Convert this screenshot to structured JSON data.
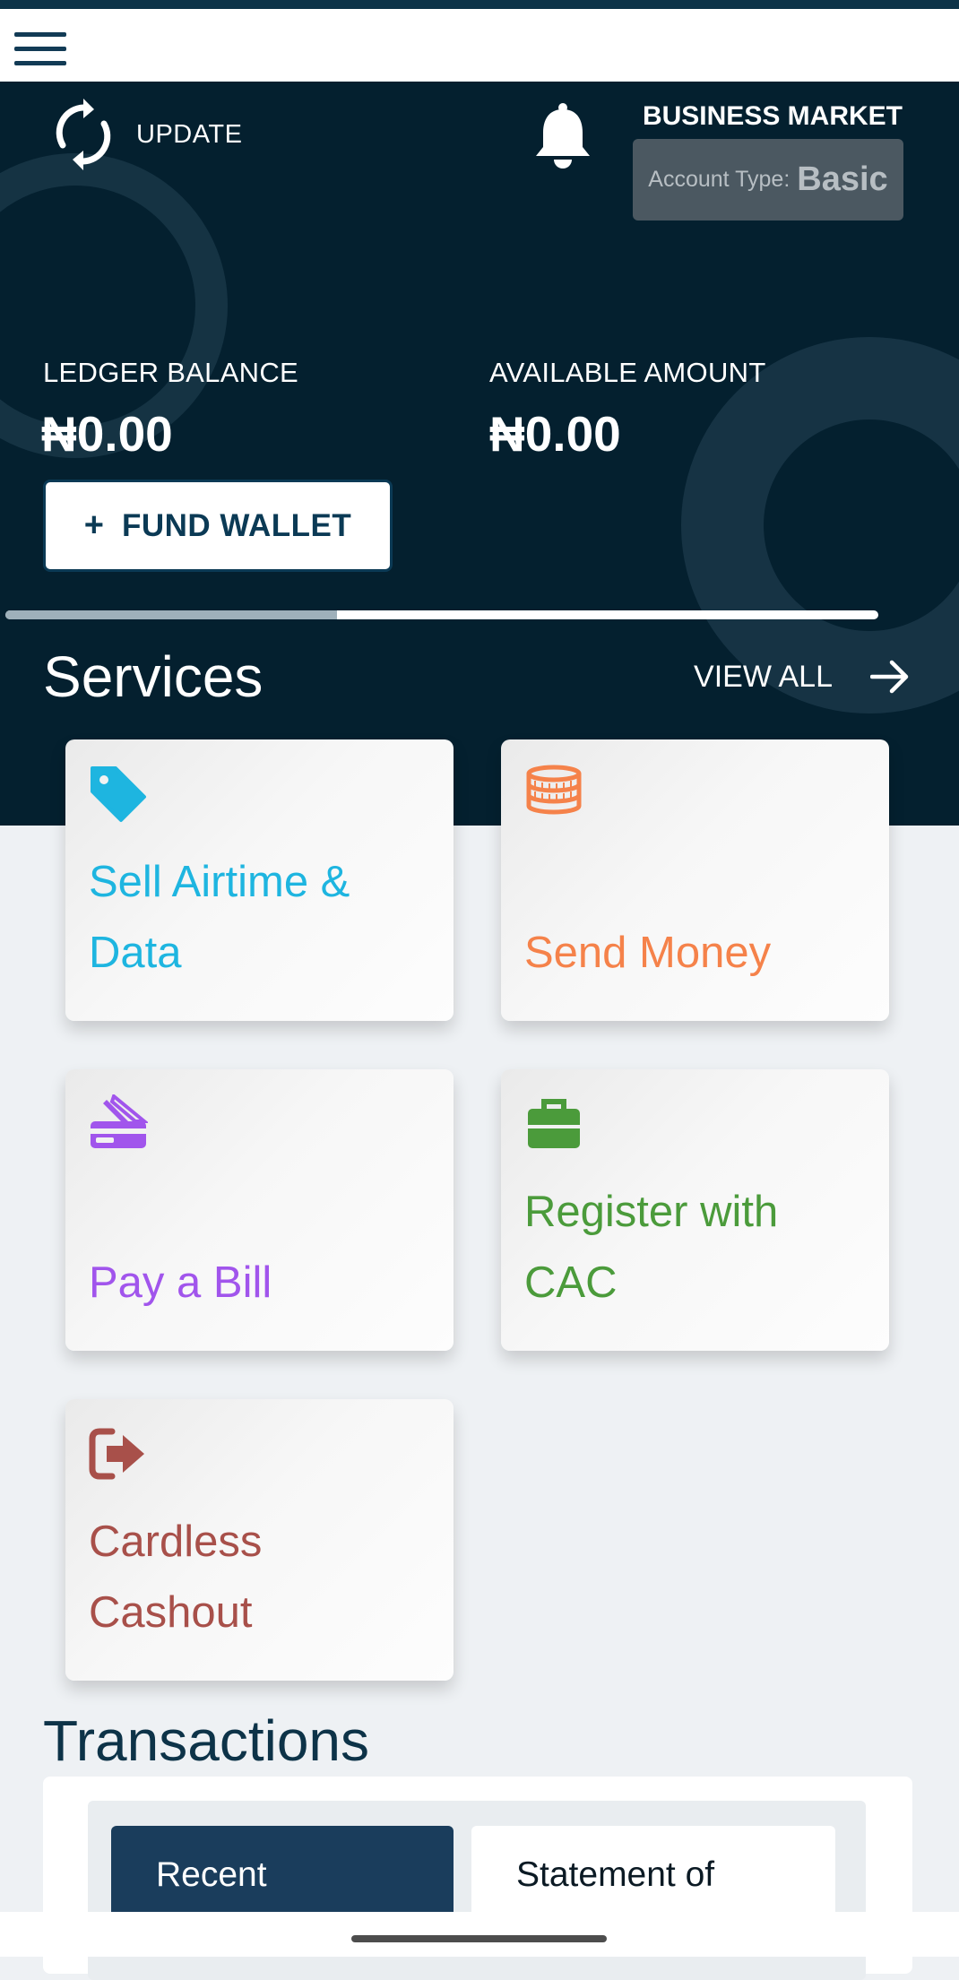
{
  "app": {
    "update_label": "UPDATE",
    "business_name": "BUSINESS MARKET",
    "account_type_label": "Account Type:",
    "account_type_value": "Basic"
  },
  "balances": {
    "ledger_label": "LEDGER BALANCE",
    "ledger_value": "₦0.00",
    "available_label": "AVAILABLE AMOUNT",
    "available_value": "₦0.00",
    "fund_wallet_label": "FUND WALLET",
    "fund_wallet_icon": "+"
  },
  "carousel": {
    "progress": 0.38
  },
  "services": {
    "title": "Services",
    "view_all_label": "VIEW ALL",
    "items": [
      {
        "label": "Sell Airtime & Data",
        "icon": "tag-icon",
        "color": "#1eb5e0"
      },
      {
        "label": "Send Money",
        "icon": "coins-icon",
        "color": "#f5824a"
      },
      {
        "label": "Pay a Bill",
        "icon": "credit-card-icon",
        "color": "#a155ec"
      },
      {
        "label": "Register with CAC",
        "icon": "briefcase-icon",
        "color": "#4b9b3b"
      },
      {
        "label": "Cardless Cashout",
        "icon": "sign-out-icon",
        "color": "#a8504a"
      }
    ]
  },
  "transactions": {
    "title": "Transactions",
    "tabs": [
      {
        "label": "Recent",
        "active": true
      },
      {
        "label": "Statement of",
        "active": false
      }
    ]
  },
  "colors": {
    "primary": "#04202f",
    "accent_dark": "#1a3d5c",
    "background": "#eef1f4"
  }
}
